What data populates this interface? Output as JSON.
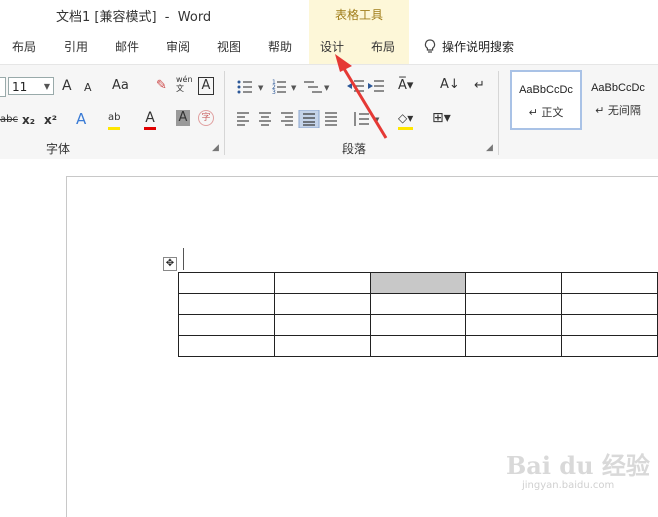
{
  "window": {
    "title": "文档1 [兼容模式]  -  Word"
  },
  "context_tab": {
    "title": "表格工具"
  },
  "tabs": [
    "布局",
    "引用",
    "邮件",
    "审阅",
    "视图",
    "帮助",
    "设计",
    "布局"
  ],
  "tell_me": "操作说明搜索",
  "font": {
    "size": "11",
    "group_label": "字体"
  },
  "font_buttons": {
    "grow": "A",
    "shrink": "A",
    "case": "Aa",
    "clear": "✎",
    "phonetic": "wén\n文",
    "border": "A",
    "strike": "abc",
    "sub": "x₂",
    "sup": "x²",
    "effects": "A",
    "highlight": "ab",
    "color": "A",
    "shade": "A",
    "circle": "字"
  },
  "paragraph": {
    "group_label": "段落"
  },
  "styles": [
    {
      "preview": "AaBbCcDc",
      "name": "正文"
    },
    {
      "preview": "AaBbCcDc",
      "name": "无间隔"
    }
  ],
  "table": {
    "rows": 4,
    "cols": 5,
    "shaded_cell": [
      0,
      2
    ]
  },
  "watermark": {
    "text": "Bai du 经验",
    "sub": "jingyan.baidu.com"
  },
  "colors": {
    "context_band": "#fdf7d8",
    "arrow": "#e53935",
    "highlight": "#ffe600",
    "font_red": "#e00000",
    "shaded_cell": "#c8c8c8"
  }
}
